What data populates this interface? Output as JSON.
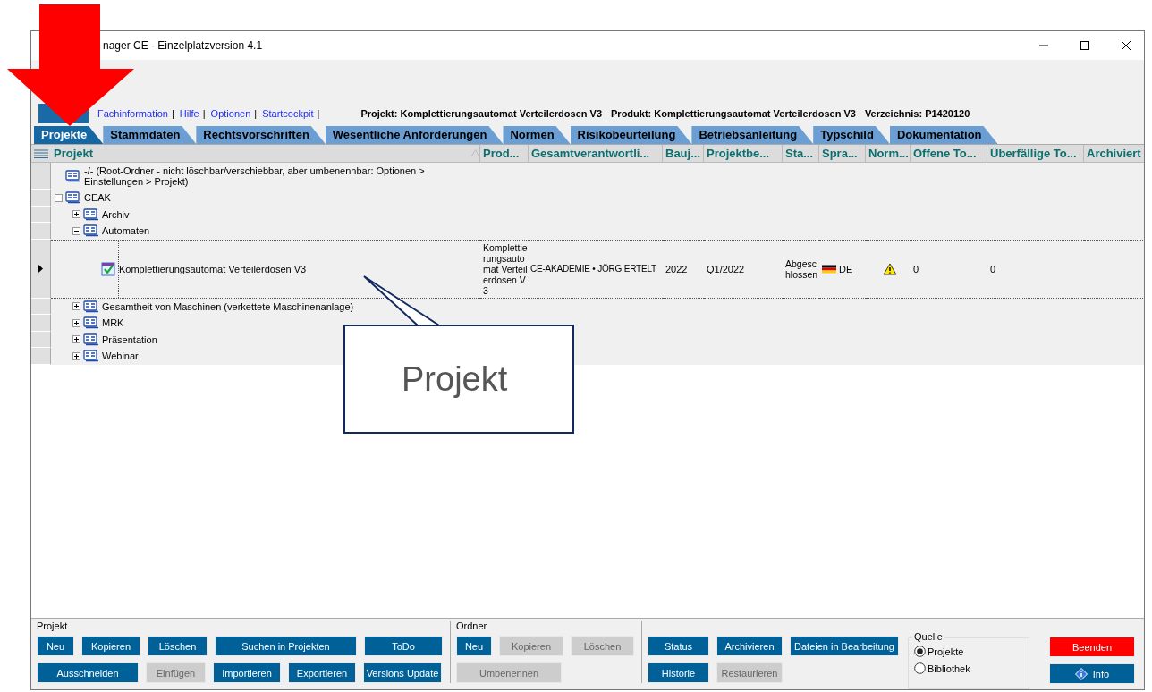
{
  "window": {
    "title": "nager CE - Einzelplatzversion 4.1"
  },
  "links": {
    "items": [
      "Fachinformation",
      "Hilfe",
      "Optionen",
      "Startcockpit"
    ],
    "separator": "|"
  },
  "info": [
    "Projekt: Komplettierungsautomat Verteilerdosen V3",
    "Produkt: Komplettierungsautomat Verteilerdosen V3",
    "Verzeichnis: P1420120"
  ],
  "tabs": [
    {
      "label": "Projekte",
      "selected": true
    },
    {
      "label": "Stammdaten",
      "selected": false
    },
    {
      "label": "Rechtsvorschriften",
      "selected": false
    },
    {
      "label": "Wesentliche Anforderungen",
      "selected": false
    },
    {
      "label": "Normen",
      "selected": false
    },
    {
      "label": "Risikobeurteilung",
      "selected": false
    },
    {
      "label": "Betriebsanleitung",
      "selected": false
    },
    {
      "label": "Typschild",
      "selected": false
    },
    {
      "label": "Dokumentation",
      "selected": false
    }
  ],
  "table": {
    "columns": [
      "Projekt",
      "Prod...",
      "Gesamtverantwortli...",
      "Bauj...",
      "Projektbe...",
      "Sta...",
      "Spra...",
      "Norm...",
      "Offene To...",
      "Überfällige To...",
      "Archiviert"
    ],
    "tree": [
      {
        "kind": "root",
        "label": "-/- (Root-Ordner - nicht löschbar/verschiebbar, aber umbenennbar: Optionen > Einstellungen > Projekt)",
        "selected": false
      },
      {
        "kind": "folder",
        "label": "CEAK",
        "expanded": true,
        "selected": false,
        "children": [
          {
            "kind": "folder",
            "label": "Archiv",
            "expanded": false,
            "selected": false
          },
          {
            "kind": "folder",
            "label": "Automaten",
            "expanded": true,
            "selected": false,
            "children": [
              {
                "kind": "project",
                "label": "Komplettierungsautomat Verteilerdosen V3",
                "selected": true,
                "product": "Komplettierungsautomat Verteilerdosen V3",
                "owner": "CE-AKADEMIE • JÖRG ERTELT",
                "year": "2022",
                "period": "Q1/2022",
                "status": "Abgeschlossen",
                "language": "DE",
                "norms_warning": true,
                "open_todos": "0",
                "overdue_todos": "0"
              }
            ]
          },
          {
            "kind": "folder",
            "label": "Gesamtheit von Maschinen (verkettete Maschinenanlage)",
            "expanded": false,
            "selected": false
          },
          {
            "kind": "folder",
            "label": "MRK",
            "expanded": false,
            "selected": false
          },
          {
            "kind": "folder",
            "label": "Präsentation",
            "expanded": false,
            "selected": false
          },
          {
            "kind": "folder",
            "label": "Webinar",
            "expanded": false,
            "selected": false
          }
        ]
      }
    ]
  },
  "callout": {
    "text": "Projekt"
  },
  "groups": [
    {
      "title": "Projekt",
      "buttons": [
        {
          "label": "Neu",
          "kind": "default",
          "disabled": false
        },
        {
          "label": "Kopieren",
          "kind": "default",
          "disabled": false
        },
        {
          "label": "Löschen",
          "kind": "default",
          "disabled": false
        },
        {
          "label": "Suchen in Projekten",
          "kind": "default",
          "disabled": false
        },
        {
          "label": "ToDo",
          "kind": "default",
          "disabled": false
        },
        {
          "label": "Ausschneiden",
          "kind": "default",
          "disabled": false
        },
        {
          "label": "Einfügen",
          "kind": "default",
          "disabled": true
        },
        {
          "label": "Importieren",
          "kind": "default",
          "disabled": false
        },
        {
          "label": "Exportieren",
          "kind": "default",
          "disabled": false
        },
        {
          "label": "Versions Update",
          "kind": "default",
          "disabled": false
        }
      ]
    },
    {
      "title": "Ordner",
      "buttons": [
        {
          "label": "Neu",
          "kind": "default",
          "disabled": false
        },
        {
          "label": "Kopieren",
          "kind": "default",
          "disabled": true
        },
        {
          "label": "Löschen",
          "kind": "default",
          "disabled": true
        },
        {
          "label": "Umbenennen",
          "kind": "default",
          "disabled": true
        }
      ]
    },
    {
      "buttons": [
        {
          "label": "Status",
          "kind": "default",
          "disabled": false
        },
        {
          "label": "Archivieren",
          "kind": "default",
          "disabled": false
        },
        {
          "label": "Dateien in Bearbeitung",
          "kind": "default",
          "disabled": false
        },
        {
          "label": "Historie",
          "kind": "default",
          "disabled": false
        },
        {
          "label": "Restaurieren",
          "kind": "default",
          "disabled": true
        }
      ]
    }
  ],
  "source": {
    "title": "Quelle",
    "options": [
      {
        "label": "Projekte",
        "selected": true
      },
      {
        "label": "Bibliothek",
        "selected": false
      }
    ]
  },
  "actions": [
    {
      "label": "Beenden",
      "kind": "danger",
      "disabled": false
    },
    {
      "label": "Info",
      "kind": "info",
      "disabled": false
    }
  ]
}
